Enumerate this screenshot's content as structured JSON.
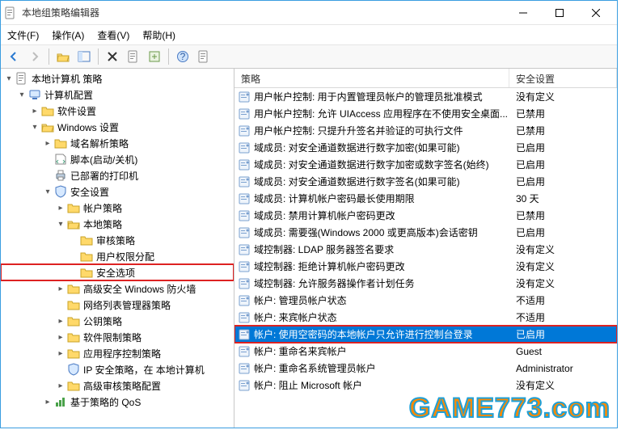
{
  "window": {
    "title": "本地组策略编辑器"
  },
  "menu": {
    "file": "文件(F)",
    "action": "操作(A)",
    "view": "查看(V)",
    "help": "帮助(H)"
  },
  "tree": {
    "root": "本地计算机 策略",
    "computer_config": "计算机配置",
    "software_settings": "软件设置",
    "windows_settings": "Windows 设置",
    "dns_policy": "域名解析策略",
    "scripts": "脚本(启动/关机)",
    "printers": "已部署的打印机",
    "security_settings": "安全设置",
    "account_policies": "帐户策略",
    "local_policies": "本地策略",
    "audit_policy": "审核策略",
    "user_rights": "用户权限分配",
    "security_options": "安全选项",
    "firewall": "高级安全 Windows 防火墙",
    "network_list": "网络列表管理器策略",
    "public_key": "公钥策略",
    "software_restriction": "软件限制策略",
    "app_control": "应用程序控制策略",
    "ip_security": "IP 安全策略，在 本地计算机",
    "advanced_audit": "高级审核策略配置",
    "qos": "基于策略的 QoS"
  },
  "list": {
    "header_policy": "策略",
    "header_setting": "安全设置",
    "rows": [
      {
        "name": "用户帐户控制: 用于内置管理员帐户的管理员批准模式",
        "value": "没有定义"
      },
      {
        "name": "用户帐户控制: 允许 UIAccess 应用程序在不使用安全桌面...",
        "value": "已禁用"
      },
      {
        "name": "用户帐户控制: 只提升升签名并验证的可执行文件",
        "value": "已禁用"
      },
      {
        "name": "域成员: 对安全通道数据进行数字加密(如果可能)",
        "value": "已启用"
      },
      {
        "name": "域成员: 对安全通道数据进行数字加密或数字签名(始终)",
        "value": "已启用"
      },
      {
        "name": "域成员: 对安全通道数据进行数字签名(如果可能)",
        "value": "已启用"
      },
      {
        "name": "域成员: 计算机帐户密码最长使用期限",
        "value": "30 天"
      },
      {
        "name": "域成员: 禁用计算机帐户密码更改",
        "value": "已禁用"
      },
      {
        "name": "域成员: 需要强(Windows 2000 或更高版本)会话密钥",
        "value": "已启用"
      },
      {
        "name": "域控制器: LDAP 服务器签名要求",
        "value": "没有定义"
      },
      {
        "name": "域控制器: 拒绝计算机帐户密码更改",
        "value": "没有定义"
      },
      {
        "name": "域控制器: 允许服务器操作者计划任务",
        "value": "没有定义"
      },
      {
        "name": "帐户: 管理员帐户状态",
        "value": "不适用"
      },
      {
        "name": "帐户: 来宾帐户状态",
        "value": "不适用"
      },
      {
        "name": "帐户: 使用空密码的本地帐户只允许进行控制台登录",
        "value": "已启用",
        "selected": true,
        "boxed": true
      },
      {
        "name": "帐户: 重命名来宾帐户",
        "value": "Guest"
      },
      {
        "name": "帐户: 重命名系统管理员帐户",
        "value": "Administrator"
      },
      {
        "name": "帐户: 阻止 Microsoft 帐户",
        "value": "没有定义"
      }
    ]
  },
  "watermark": "GAME773.com"
}
